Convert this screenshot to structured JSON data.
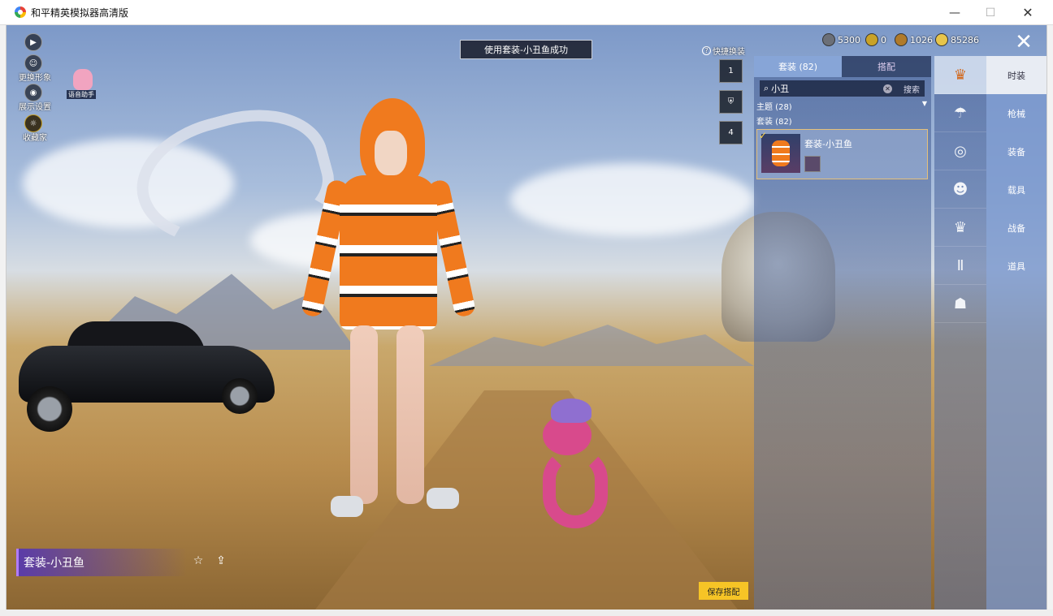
{
  "window": {
    "title": "和平精英模拟器高清版",
    "min": "—",
    "max": "☐",
    "close": "✕"
  },
  "left_buttons": [
    {
      "icon": "▶",
      "label": ""
    },
    {
      "icon": "☺",
      "label": "更换形象"
    },
    {
      "icon": "◉",
      "label": "展示设置"
    },
    {
      "icon": "☼",
      "label": "收藏家"
    }
  ],
  "voice_assistant": {
    "label": "语音助手"
  },
  "notice": "使用套装-小丑鱼成功",
  "currencies": [
    {
      "value": "5300",
      "color": "#6b6f78"
    },
    {
      "value": "0",
      "color": "#c9a227"
    },
    {
      "value": "1026",
      "color": "#b07a2a"
    },
    {
      "value": "85286",
      "color": "#e7c54b"
    }
  ],
  "close_label": "✕",
  "quick_change": {
    "icon": "?",
    "label": "快捷换装"
  },
  "quick_slots": [
    "1",
    "⛨",
    "4"
  ],
  "panel": {
    "tabs": [
      "套装 (82)",
      "搭配"
    ],
    "search": {
      "value": "小丑",
      "button": "搜索",
      "clear": "✕",
      "icon": "⌕"
    },
    "theme_filter": "主题 (28)",
    "suit_filter": "套装 (82)",
    "result": {
      "name": "套装-小丑鱼",
      "check": "✓"
    }
  },
  "category_icons": [
    "♛",
    "☂",
    "◎",
    "☻",
    "♛",
    "Ⅱ",
    "☗"
  ],
  "menu": [
    "时装",
    "枪械",
    "装备",
    "载具",
    "战备",
    "道具"
  ],
  "outfit_name": "套装-小丑鱼",
  "share_icons": [
    "☆",
    "⇪"
  ],
  "save_button": "保存搭配"
}
